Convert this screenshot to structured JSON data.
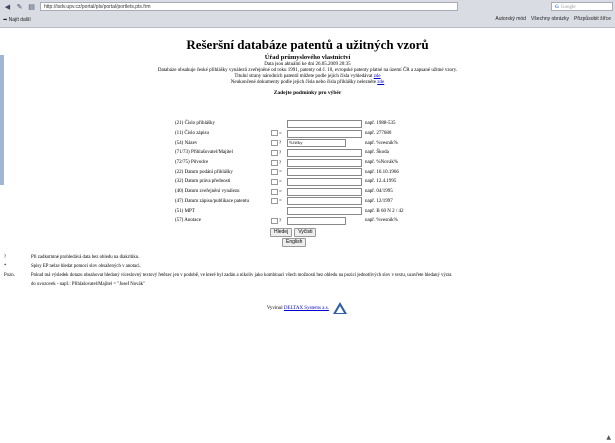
{
  "browser": {
    "url": "http://isdv.upv.cz/portal/pls/portal/portlets.pts.frm",
    "search_placeholder": "Google",
    "bookmark_left": "Najít další",
    "bookmarks_right": [
      "Autorský mód",
      "Všechny obrázky",
      "Přizpůsobit šířce"
    ]
  },
  "header": {
    "title": "Rešeršní databáze patentů a užitných vzorů",
    "office": "Úřad průmyslového vlastnictví",
    "updated": "Data jsou aktuální ke dni 26.05.2009 20:35",
    "description": "Databáze obsahuje české přihlášky vynálezů zveřejněné od roku 1991, patenty od č. 10, evropské patenty platné na území ČR a zapsané užitné vzory.",
    "note1_text": "Titulní strany národních patentů můžete podle jejich čísla vyhledávat",
    "note1_link": "zde",
    "note2_text": "Neukončené dokumenty podle jejich čísla nebo čísla přihlášky nelezněte",
    "note2_link": "zde"
  },
  "form": {
    "heading": "Zadejte podmínky pro výběr",
    "rows": [
      {
        "label": "(21) Číslo přihlášky",
        "op": "",
        "value": "",
        "example": "např. 1988-535"
      },
      {
        "label": "(11) Číslo zápisu",
        "op": "=",
        "value": "",
        "example": "např. 277680"
      },
      {
        "label": "(54) Název",
        "op": "?",
        "value": "%čtčky",
        "example": "např. %vesnik%"
      },
      {
        "label": "(71/73) Přihlašovatel/Majitel",
        "op": "?",
        "value": "",
        "example": "např. Škoda"
      },
      {
        "label": "(72/75) Původce",
        "op": "?",
        "value": "",
        "example": "např. %Novák%"
      },
      {
        "label": "(22) Datum podání přihlášky",
        "op": "=",
        "value": "",
        "example": "např. 16.10.1966"
      },
      {
        "label": "(32) Datum práva přednosti",
        "op": "=",
        "value": "",
        "example": "např. 12.4.1995"
      },
      {
        "label": "(40) Datum zveřejnění vynálezu",
        "op": "=",
        "value": "",
        "example": "např. 04/1995"
      },
      {
        "label": "(47) Datum zápisu/publikace patentu",
        "op": "=",
        "value": "",
        "example": "např. 12/1997"
      },
      {
        "label": "(51) MPT",
        "op": "",
        "value": "",
        "example": "např. B 60 N 2 / 42"
      },
      {
        "label": "(57) Anotace",
        "op": "?",
        "value": "",
        "example": "např. %vesnik%"
      }
    ],
    "search_button": "Hledej",
    "clear_button": "Vyčisti",
    "english_button": "English"
  },
  "notes": [
    {
      "symbol": "?",
      "text": "Při zadkotmné prohledává data bez ohledu na diakritiku."
    },
    {
      "symbol": "*",
      "text": "Spisy EP nelze hledat pomocí slov obsažených v anotaci."
    },
    {
      "symbol": "Pozn.",
      "text": "Pokud má výsledek dotazu obsahovat hledaný víceslovný textový řetězec jen v podobě, ve které byl zadán a nikoliv jako kombinaci všech možností bez ohledu na pozici jednotlivých slov v textu, uzavřete hledaný výraz"
    },
    {
      "symbol": "",
      "text": "do uvozovek - např.: Přihlašovatel/Majitel = \"Josef Novák\""
    }
  ],
  "footer": {
    "text": "Vyvinul",
    "link": "DELTAX Systems a.s."
  },
  "colors": {
    "accent": "#0000cc",
    "chrome": "#d9dce2",
    "logo": "#2f5fa8"
  }
}
